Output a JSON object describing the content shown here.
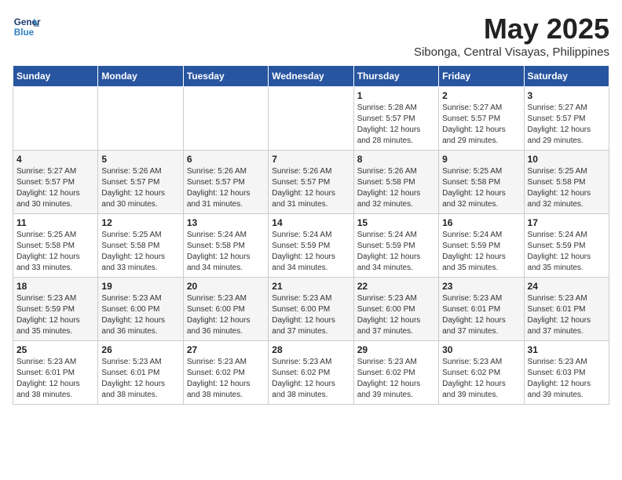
{
  "header": {
    "logo_line1": "General",
    "logo_line2": "Blue",
    "month": "May 2025",
    "location": "Sibonga, Central Visayas, Philippines"
  },
  "weekdays": [
    "Sunday",
    "Monday",
    "Tuesday",
    "Wednesday",
    "Thursday",
    "Friday",
    "Saturday"
  ],
  "weeks": [
    [
      {
        "day": "",
        "info": ""
      },
      {
        "day": "",
        "info": ""
      },
      {
        "day": "",
        "info": ""
      },
      {
        "day": "",
        "info": ""
      },
      {
        "day": "1",
        "info": "Sunrise: 5:28 AM\nSunset: 5:57 PM\nDaylight: 12 hours\nand 28 minutes."
      },
      {
        "day": "2",
        "info": "Sunrise: 5:27 AM\nSunset: 5:57 PM\nDaylight: 12 hours\nand 29 minutes."
      },
      {
        "day": "3",
        "info": "Sunrise: 5:27 AM\nSunset: 5:57 PM\nDaylight: 12 hours\nand 29 minutes."
      }
    ],
    [
      {
        "day": "4",
        "info": "Sunrise: 5:27 AM\nSunset: 5:57 PM\nDaylight: 12 hours\nand 30 minutes."
      },
      {
        "day": "5",
        "info": "Sunrise: 5:26 AM\nSunset: 5:57 PM\nDaylight: 12 hours\nand 30 minutes."
      },
      {
        "day": "6",
        "info": "Sunrise: 5:26 AM\nSunset: 5:57 PM\nDaylight: 12 hours\nand 31 minutes."
      },
      {
        "day": "7",
        "info": "Sunrise: 5:26 AM\nSunset: 5:57 PM\nDaylight: 12 hours\nand 31 minutes."
      },
      {
        "day": "8",
        "info": "Sunrise: 5:26 AM\nSunset: 5:58 PM\nDaylight: 12 hours\nand 32 minutes."
      },
      {
        "day": "9",
        "info": "Sunrise: 5:25 AM\nSunset: 5:58 PM\nDaylight: 12 hours\nand 32 minutes."
      },
      {
        "day": "10",
        "info": "Sunrise: 5:25 AM\nSunset: 5:58 PM\nDaylight: 12 hours\nand 32 minutes."
      }
    ],
    [
      {
        "day": "11",
        "info": "Sunrise: 5:25 AM\nSunset: 5:58 PM\nDaylight: 12 hours\nand 33 minutes."
      },
      {
        "day": "12",
        "info": "Sunrise: 5:25 AM\nSunset: 5:58 PM\nDaylight: 12 hours\nand 33 minutes."
      },
      {
        "day": "13",
        "info": "Sunrise: 5:24 AM\nSunset: 5:58 PM\nDaylight: 12 hours\nand 34 minutes."
      },
      {
        "day": "14",
        "info": "Sunrise: 5:24 AM\nSunset: 5:59 PM\nDaylight: 12 hours\nand 34 minutes."
      },
      {
        "day": "15",
        "info": "Sunrise: 5:24 AM\nSunset: 5:59 PM\nDaylight: 12 hours\nand 34 minutes."
      },
      {
        "day": "16",
        "info": "Sunrise: 5:24 AM\nSunset: 5:59 PM\nDaylight: 12 hours\nand 35 minutes."
      },
      {
        "day": "17",
        "info": "Sunrise: 5:24 AM\nSunset: 5:59 PM\nDaylight: 12 hours\nand 35 minutes."
      }
    ],
    [
      {
        "day": "18",
        "info": "Sunrise: 5:23 AM\nSunset: 5:59 PM\nDaylight: 12 hours\nand 35 minutes."
      },
      {
        "day": "19",
        "info": "Sunrise: 5:23 AM\nSunset: 6:00 PM\nDaylight: 12 hours\nand 36 minutes."
      },
      {
        "day": "20",
        "info": "Sunrise: 5:23 AM\nSunset: 6:00 PM\nDaylight: 12 hours\nand 36 minutes."
      },
      {
        "day": "21",
        "info": "Sunrise: 5:23 AM\nSunset: 6:00 PM\nDaylight: 12 hours\nand 37 minutes."
      },
      {
        "day": "22",
        "info": "Sunrise: 5:23 AM\nSunset: 6:00 PM\nDaylight: 12 hours\nand 37 minutes."
      },
      {
        "day": "23",
        "info": "Sunrise: 5:23 AM\nSunset: 6:01 PM\nDaylight: 12 hours\nand 37 minutes."
      },
      {
        "day": "24",
        "info": "Sunrise: 5:23 AM\nSunset: 6:01 PM\nDaylight: 12 hours\nand 37 minutes."
      }
    ],
    [
      {
        "day": "25",
        "info": "Sunrise: 5:23 AM\nSunset: 6:01 PM\nDaylight: 12 hours\nand 38 minutes."
      },
      {
        "day": "26",
        "info": "Sunrise: 5:23 AM\nSunset: 6:01 PM\nDaylight: 12 hours\nand 38 minutes."
      },
      {
        "day": "27",
        "info": "Sunrise: 5:23 AM\nSunset: 6:02 PM\nDaylight: 12 hours\nand 38 minutes."
      },
      {
        "day": "28",
        "info": "Sunrise: 5:23 AM\nSunset: 6:02 PM\nDaylight: 12 hours\nand 38 minutes."
      },
      {
        "day": "29",
        "info": "Sunrise: 5:23 AM\nSunset: 6:02 PM\nDaylight: 12 hours\nand 39 minutes."
      },
      {
        "day": "30",
        "info": "Sunrise: 5:23 AM\nSunset: 6:02 PM\nDaylight: 12 hours\nand 39 minutes."
      },
      {
        "day": "31",
        "info": "Sunrise: 5:23 AM\nSunset: 6:03 PM\nDaylight: 12 hours\nand 39 minutes."
      }
    ]
  ]
}
